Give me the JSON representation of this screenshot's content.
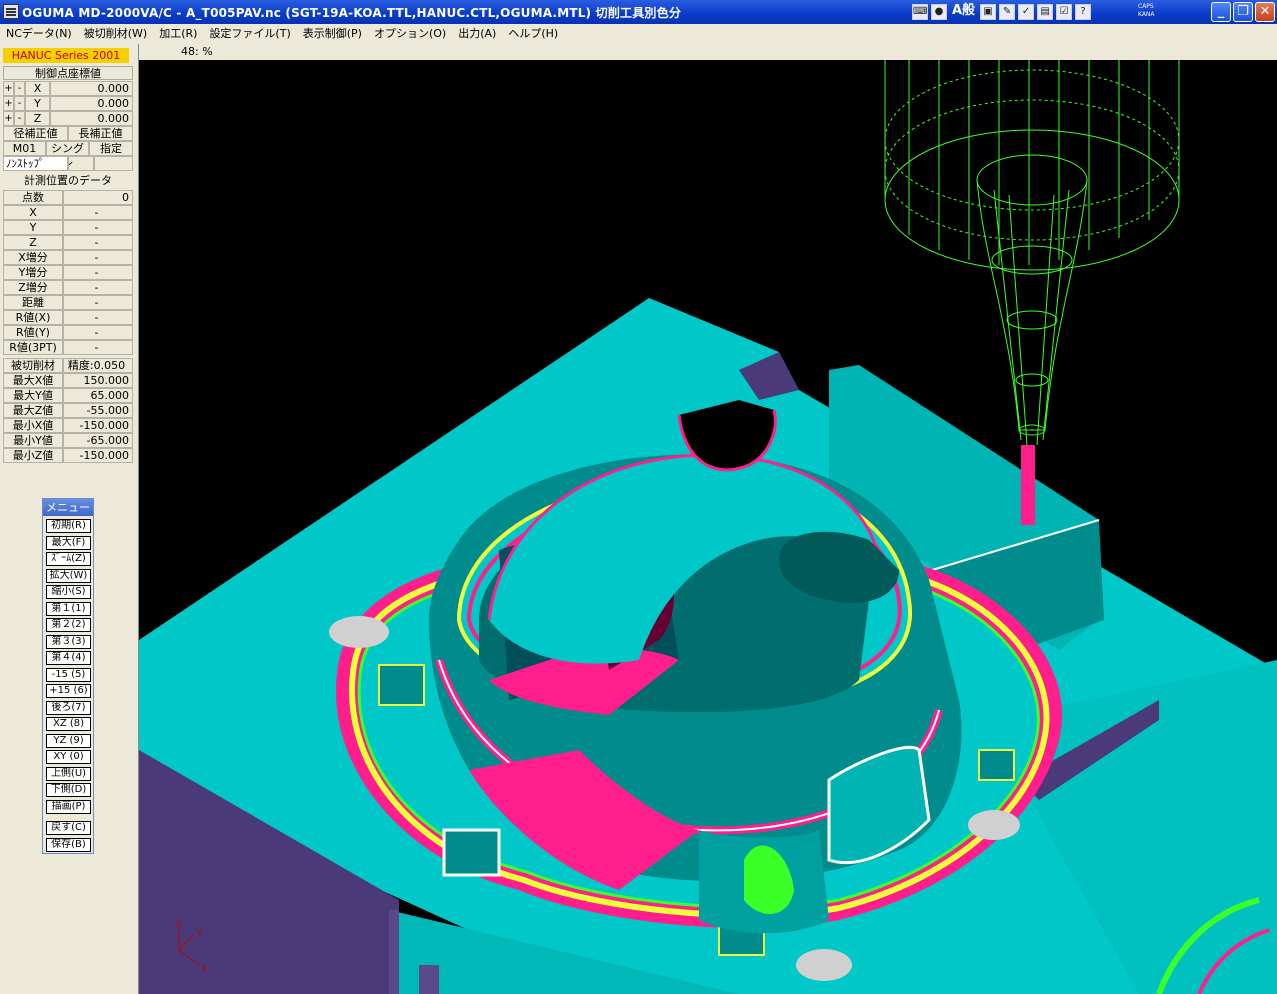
{
  "window": {
    "title": "OGUMA MD-2000VA/C - A_T005PAV.nc (SGT-19A-KOA.TTL,HANUC.CTL,OGUMA.MTL) 切削工具別色分",
    "tray_text": "A般",
    "caps": "CAPS",
    "kana": "KANA",
    "minimize": "_",
    "maximize": "❐",
    "close": "✕"
  },
  "menubar": {
    "items": [
      "NCデータ(N)",
      "被切削材(W)",
      "加工(R)",
      "設定ファイル(T)",
      "表示制御(P)",
      "オプション(O)",
      "出力(A)",
      "ヘルプ(H)"
    ]
  },
  "zoom": "48: %",
  "panel": {
    "series": "HANUC Series 2001",
    "control_header": "制御点座標値",
    "plus": "+",
    "minus": "-",
    "axes": [
      {
        "axis": "X",
        "value": "0.000"
      },
      {
        "axis": "Y",
        "value": "0.000"
      },
      {
        "axis": "Z",
        "value": "0.000"
      }
    ],
    "radius_comp": "径補正値",
    "length_comp": "長補正値",
    "m01": "M01",
    "single": "シングル",
    "specify": "指定",
    "nonstop": "ﾉﾝｽﾄｯﾌﾟ",
    "measure_header": "計測位置のデータ",
    "measure_rows": [
      {
        "label": "点数",
        "value": "0"
      },
      {
        "label": "X",
        "value": "-"
      },
      {
        "label": "Y",
        "value": "-"
      },
      {
        "label": "Z",
        "value": "-"
      },
      {
        "label": "X増分",
        "value": "-"
      },
      {
        "label": "Y増分",
        "value": "-"
      },
      {
        "label": "Z増分",
        "value": "-"
      },
      {
        "label": "距離",
        "value": "-"
      },
      {
        "label": "R値(X)",
        "value": "-"
      },
      {
        "label": "R値(Y)",
        "value": "-"
      },
      {
        "label": "R値(3PT)",
        "value": "-"
      }
    ],
    "workpiece": "被切削材",
    "precision": "精度:0.050",
    "workpiece_rows": [
      {
        "label": "最大X値",
        "value": "150.000"
      },
      {
        "label": "最大Y値",
        "value": "65.000"
      },
      {
        "label": "最大Z値",
        "value": "-55.000"
      },
      {
        "label": "最小X値",
        "value": "-150.000"
      },
      {
        "label": "最小Y値",
        "value": "-65.000"
      },
      {
        "label": "最小Z値",
        "value": "-150.000"
      }
    ]
  },
  "menu": {
    "title": "メニュー",
    "items": [
      "初期(R)",
      "最大(F)",
      "ｽﾞｰﾑ(Z)",
      "拡大(W)",
      "縮小(S)",
      "第１(1)",
      "第２(2)",
      "第３(3)",
      "第４(4)",
      "-15 (5)",
      "+15 (6)",
      "後ろ(7)",
      "XZ (8)",
      "YZ (9)",
      "XY (0)",
      "上側(U)",
      "下側(D)",
      "描画(P)",
      "戻す(C)",
      "保存(B)"
    ]
  },
  "view_axes": {
    "x": "X",
    "y": "Y",
    "z": "Z"
  },
  "colors": {
    "stock": "#00c8c8",
    "stock_dark": "#008c8c",
    "side": "#4a3a7a",
    "gouge": "#ff1e8c",
    "tool": "#3cff28",
    "accent_yellow": "#f0ff3c"
  }
}
